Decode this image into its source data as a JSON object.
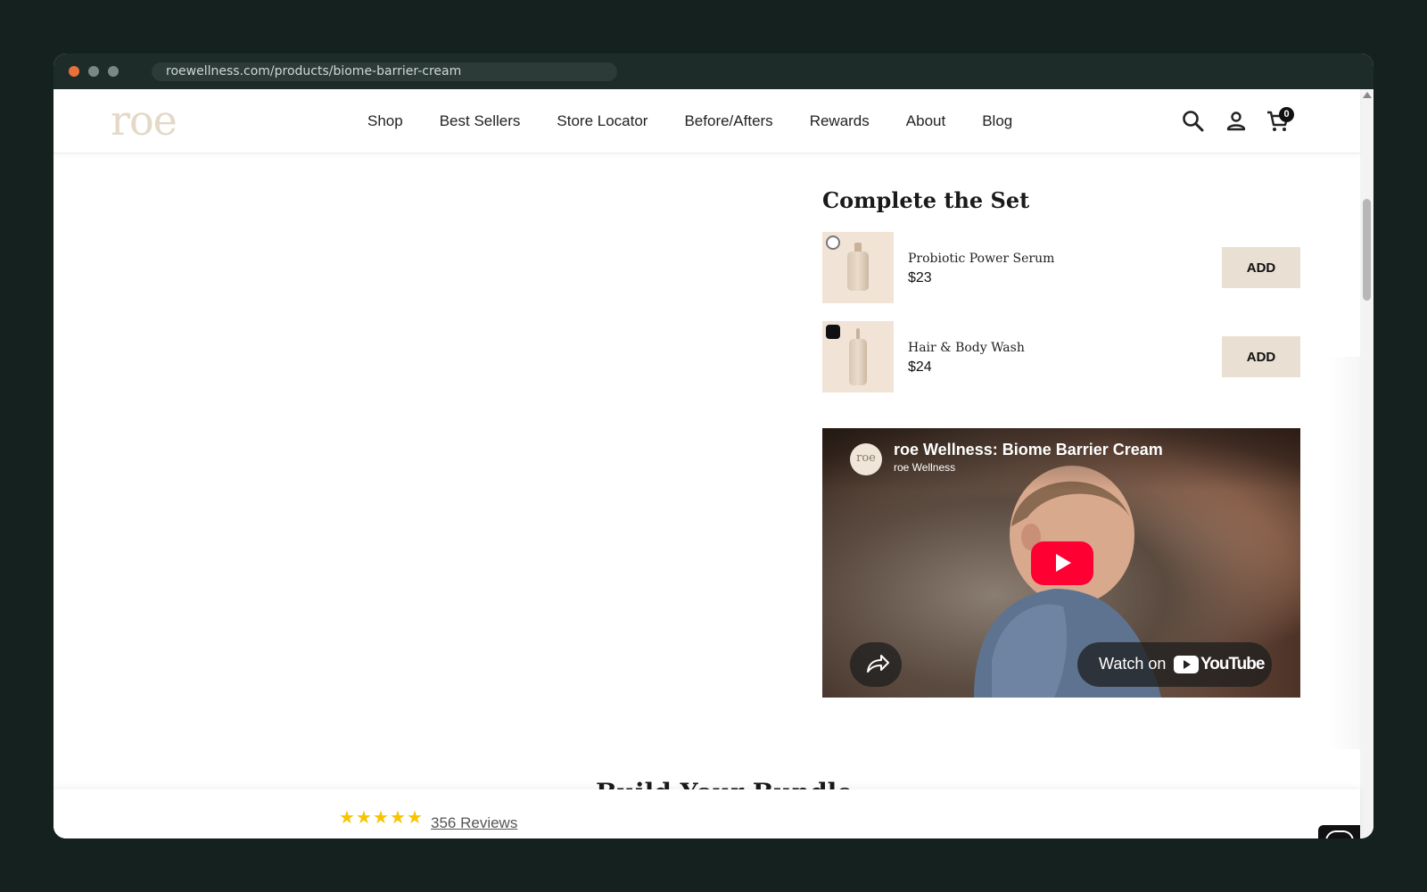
{
  "browser": {
    "url": "roewellness.com/products/biome-barrier-cream"
  },
  "header": {
    "logo": "roe",
    "nav": [
      "Shop",
      "Best Sellers",
      "Store Locator",
      "Before/Afters",
      "Rewards",
      "About",
      "Blog"
    ],
    "cart_count": "0",
    "icons": [
      "search-icon",
      "account-icon",
      "cart-icon"
    ]
  },
  "complete_set": {
    "title": "Complete the Set",
    "items": [
      {
        "name": "Probiotic Power Serum",
        "price": "$23",
        "button": "ADD"
      },
      {
        "name": "Hair & Body Wash",
        "price": "$24",
        "button": "ADD"
      }
    ]
  },
  "video": {
    "title": "roe Wellness: Biome Barrier Cream",
    "channel": "roe Wellness",
    "avatar_text": "roe",
    "watch_on": "Watch on",
    "youtube": "YouTube"
  },
  "bundle": {
    "title": "Build Your Bundle"
  },
  "sticky": {
    "rating_stars": 5,
    "reviews": "356 Reviews"
  },
  "colors": {
    "logo": "#e4d8c7",
    "add_button": "#eadfd3",
    "thumb_bg": "#f1e3d6",
    "star": "#f6c400",
    "play_button": "#ff0033"
  }
}
